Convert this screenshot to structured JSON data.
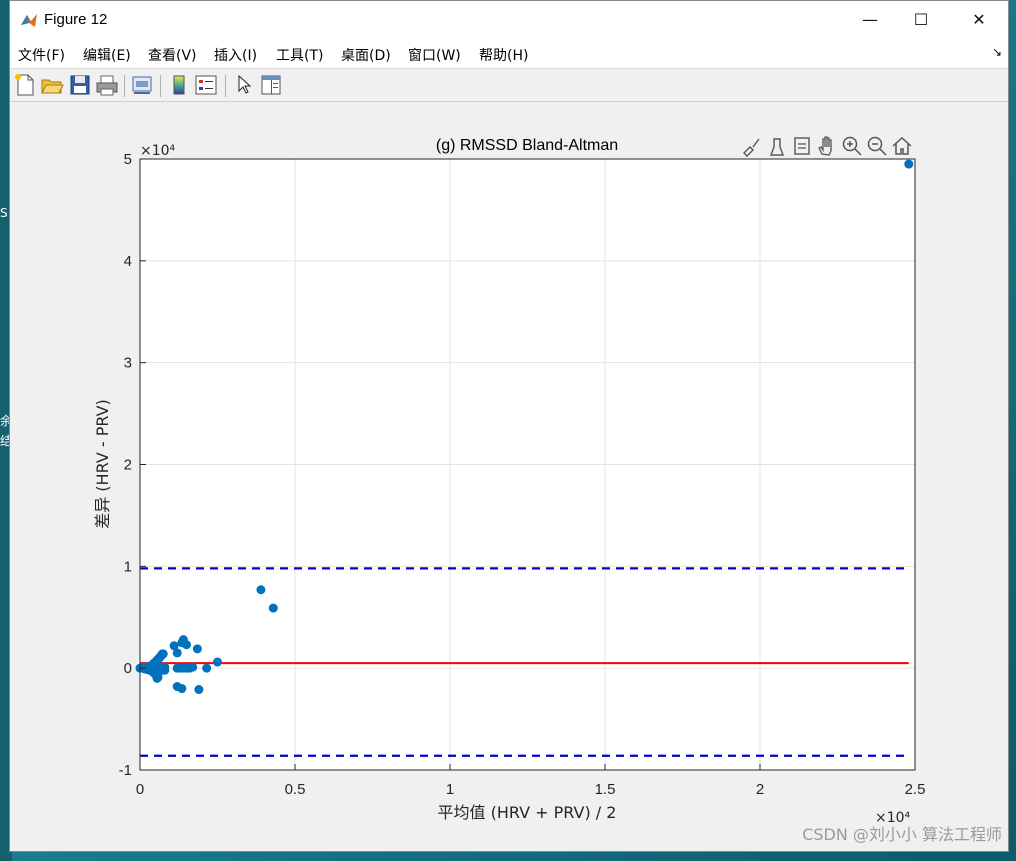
{
  "window": {
    "title": "Figure 12",
    "controls": {
      "minimize": "—",
      "maximize": "☐",
      "close": "✕"
    }
  },
  "desktop": {
    "edge_text_1": "S",
    "edge_text_2": "余",
    "edge_text_3": "结"
  },
  "menu": {
    "items": [
      "文件(F)",
      "编辑(E)",
      "查看(V)",
      "插入(I)",
      "工具(T)",
      "桌面(D)",
      "窗口(W)",
      "帮助(H)"
    ],
    "overflow": "↘"
  },
  "toolbar": {
    "buttons": [
      "new-figure-icon",
      "open-file-icon",
      "save-icon",
      "print-icon",
      "print-preview-icon",
      "colorbar-icon",
      "legend-icon",
      "pointer-icon",
      "property-editor-icon"
    ]
  },
  "axes_toolbar": {
    "buttons": [
      "brush-icon",
      "data-cursor-icon",
      "datatip-icon",
      "pan-icon",
      "zoom-in-icon",
      "zoom-out-icon",
      "home-icon"
    ]
  },
  "chart_data": {
    "type": "scatter",
    "title": "(g) RMSSD Bland-Altman",
    "xlabel": "平均值 (HRV + PRV) / 2",
    "ylabel": "差异 (HRV - PRV)",
    "x_exponent_label": "×10⁴",
    "y_exponent_label": "×10⁴",
    "xlim": [
      0,
      25000
    ],
    "ylim": [
      -10000,
      50000
    ],
    "xticks": [
      0,
      5000,
      10000,
      15000,
      20000,
      25000
    ],
    "xtick_labels": [
      "0",
      "0.5",
      "1",
      "1.5",
      "2",
      "2.5"
    ],
    "yticks": [
      -10000,
      0,
      10000,
      20000,
      30000,
      40000,
      50000
    ],
    "ytick_labels": [
      "-1",
      "0",
      "1",
      "2",
      "3",
      "4",
      "5"
    ],
    "grid": true,
    "point_color": "#0072BD",
    "points": [
      [
        0,
        0
      ],
      [
        100,
        50
      ],
      [
        150,
        -80
      ],
      [
        200,
        100
      ],
      [
        250,
        -150
      ],
      [
        300,
        200
      ],
      [
        350,
        -250
      ],
      [
        400,
        300
      ],
      [
        420,
        -400
      ],
      [
        450,
        500
      ],
      [
        480,
        -550
      ],
      [
        500,
        600
      ],
      [
        520,
        -700
      ],
      [
        550,
        800
      ],
      [
        580,
        -900
      ],
      [
        600,
        900
      ],
      [
        620,
        1000
      ],
      [
        650,
        1100
      ],
      [
        680,
        1200
      ],
      [
        700,
        1300
      ],
      [
        720,
        1400
      ],
      [
        750,
        1400
      ],
      [
        400,
        0
      ],
      [
        500,
        100
      ],
      [
        600,
        200
      ],
      [
        650,
        -300
      ],
      [
        700,
        0
      ],
      [
        750,
        50
      ],
      [
        800,
        100
      ],
      [
        550,
        -1000
      ],
      [
        800,
        -200
      ],
      [
        1100,
        2200
      ],
      [
        1200,
        1500
      ],
      [
        1350,
        2500
      ],
      [
        1400,
        2800
      ],
      [
        1500,
        2300
      ],
      [
        1200,
        0
      ],
      [
        1300,
        0
      ],
      [
        1400,
        0
      ],
      [
        1500,
        0
      ],
      [
        1600,
        0
      ],
      [
        1700,
        100
      ],
      [
        1200,
        -1800
      ],
      [
        1350,
        -2000
      ],
      [
        1900,
        -2100
      ],
      [
        1850,
        1900
      ],
      [
        2150,
        0
      ],
      [
        2500,
        600
      ],
      [
        3900,
        7700
      ],
      [
        4300,
        5900
      ],
      [
        24800,
        49500
      ]
    ],
    "mean_line": {
      "y": 500,
      "color": "#FF0000"
    },
    "limits_of_agreement": [
      {
        "y": 9800,
        "color": "#0000CC",
        "style": "dashed"
      },
      {
        "y": -8600,
        "color": "#0000CC",
        "style": "dashed"
      }
    ],
    "line_x_range": [
      0,
      24800
    ]
  },
  "watermark": "CSDN @刘小小 算法工程师"
}
